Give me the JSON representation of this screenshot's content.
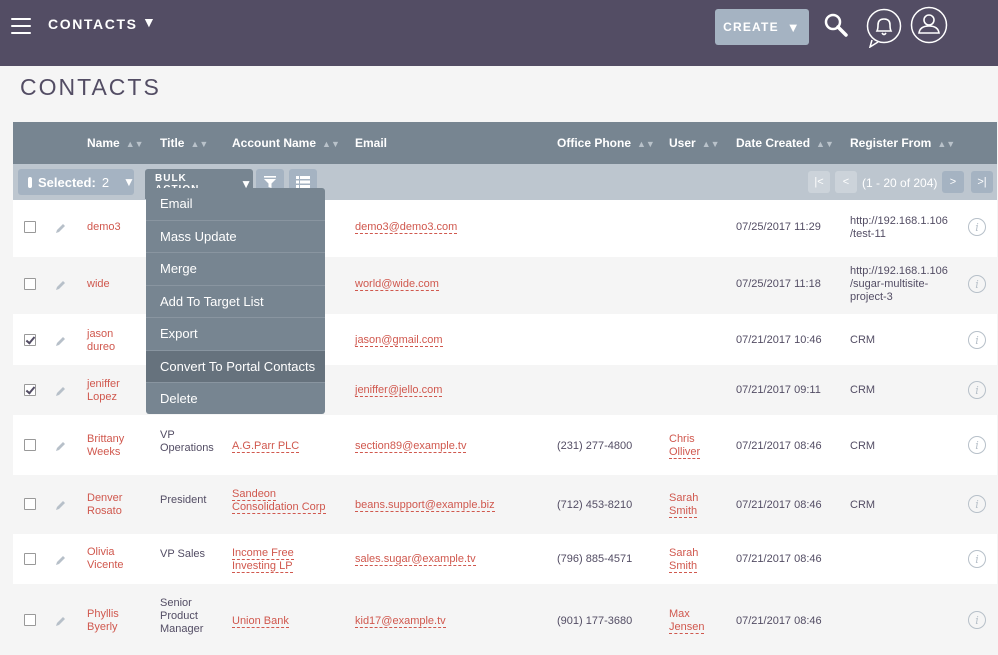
{
  "topbar": {
    "module": "CONTACTS",
    "create_label": "CREATE",
    "icons": [
      "hamburger-icon",
      "search-icon",
      "bell-icon",
      "user-icon"
    ]
  },
  "page_title": "CONTACTS",
  "columns": [
    "Name",
    "Title",
    "Account Name",
    "Email",
    "Office Phone",
    "User",
    "Date Created",
    "Register From"
  ],
  "action_bar": {
    "selected_label": "Selected:",
    "selected_count": "2",
    "bulk_action_label": "BULK ACTION",
    "pagination": "(1 - 20 of 204)"
  },
  "bulk_menu": [
    "Email",
    "Mass Update",
    "Merge",
    "Add To Target List",
    "Export",
    "Convert To Portal Contacts",
    "Delete"
  ],
  "rows": [
    {
      "first": "demo3",
      "last": "",
      "title": "",
      "account": "",
      "email": "demo3@demo3.com",
      "phone": "",
      "user_first": "",
      "user_last": "",
      "date": "07/25/2017 11:29",
      "register_1": "http://192.168.1.106",
      "register_2": "/test-11",
      "register_3": "",
      "checked": false
    },
    {
      "first": "wide",
      "last": "",
      "title": "",
      "account": "",
      "email": "world@wide.com",
      "phone": "",
      "user_first": "",
      "user_last": "",
      "date": "07/25/2017 11:18",
      "register_1": "http://192.168.1.106",
      "register_2": "/sugar-multisite-",
      "register_3": "project-3",
      "checked": false
    },
    {
      "first": "jason",
      "last": "dureo",
      "title": "",
      "account": "",
      "email": "jason@gmail.com",
      "phone": "",
      "user_first": "",
      "user_last": "",
      "date": "07/21/2017 10:46",
      "register_1": "CRM",
      "register_2": "",
      "register_3": "",
      "checked": true
    },
    {
      "first": "jeniffer",
      "last": "Lopez",
      "title": "",
      "account": "",
      "email": "jeniffer@jello.com",
      "phone": "",
      "user_first": "",
      "user_last": "",
      "date": "07/21/2017 09:11",
      "register_1": "CRM",
      "register_2": "",
      "register_3": "",
      "checked": true
    },
    {
      "first": "Brittany",
      "last": "Weeks",
      "title_1": "VP",
      "title_2": "Operations",
      "account": "A.G.Parr PLC",
      "email": "section89@example.tv",
      "phone": "(231) 277-4800",
      "user_first": "Chris",
      "user_last": "Olliver",
      "date": "07/21/2017 08:46",
      "register_1": "CRM",
      "register_2": "",
      "register_3": "",
      "checked": false
    },
    {
      "first": "Denver",
      "last": "Rosato",
      "title_1": "President",
      "account_1": "Sandeon",
      "account_2": "Consolidation Corp",
      "email": "beans.support@example.biz",
      "phone": "(712) 453-8210",
      "user_first": "Sarah",
      "user_last": "Smith",
      "date": "07/21/2017 08:46",
      "register_1": "CRM",
      "register_2": "",
      "register_3": "",
      "checked": false
    },
    {
      "first": "Olivia",
      "last": "Vicente",
      "title_1": "VP Sales",
      "account_1": "Income Free",
      "account_2": "Investing LP",
      "email": "sales.sugar@example.tv",
      "phone": "(796) 885-4571",
      "user_first": "Sarah",
      "user_last": "Smith",
      "date": "07/21/2017 08:46",
      "register_1": "",
      "register_2": "",
      "register_3": "",
      "checked": false
    },
    {
      "first": "Phyllis",
      "last": "Byerly",
      "title_1": "Senior",
      "title_2": "Product",
      "title_3": "Manager",
      "account_1": "Union Bank",
      "email": "kid17@example.tv",
      "phone": "(901) 177-3680",
      "user_first": "Max",
      "user_last": "Jensen",
      "date": "07/21/2017 08:46",
      "register_1": "",
      "register_2": "",
      "register_3": "",
      "checked": false
    }
  ],
  "colors": {
    "topbar": "#534d64",
    "header": "#778591",
    "link": "#d0584e",
    "action_bar": "#bdc6cf"
  }
}
